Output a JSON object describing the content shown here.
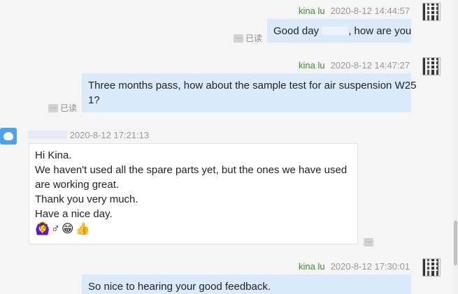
{
  "messages": [
    {
      "sender": "kina lu",
      "time": "2020-8-12 14:44:57",
      "text_before": "Good day ",
      "text_after": ", how are you",
      "read_status": "已读"
    },
    {
      "sender": "kina lu",
      "time": "2020-8-12 14:47:27",
      "lines": [
        "Three months pass, how about the sample test for air suspension W25",
        "1?"
      ],
      "read_status": "已读"
    },
    {
      "time": "2020-8-12 17:21:13",
      "lines": [
        "Hi Kina.",
        "We haven't used all the spare parts yet, but the ones we have used",
        "are working great.",
        "Thank you very much.",
        "Have a nice day."
      ],
      "emojis": "🙆‍♀️♂😁👍"
    },
    {
      "sender": "kina lu",
      "time": "2020-8-12 17:30:01",
      "lines": [
        "So nice to hearing your good feedback."
      ]
    }
  ],
  "more_label": "···",
  "colors": {
    "outgoing_bubble": "#dbeafb",
    "incoming_bubble": "#ffffff",
    "sender_name": "#3d8b2c",
    "avatar": "#4da3ea"
  }
}
